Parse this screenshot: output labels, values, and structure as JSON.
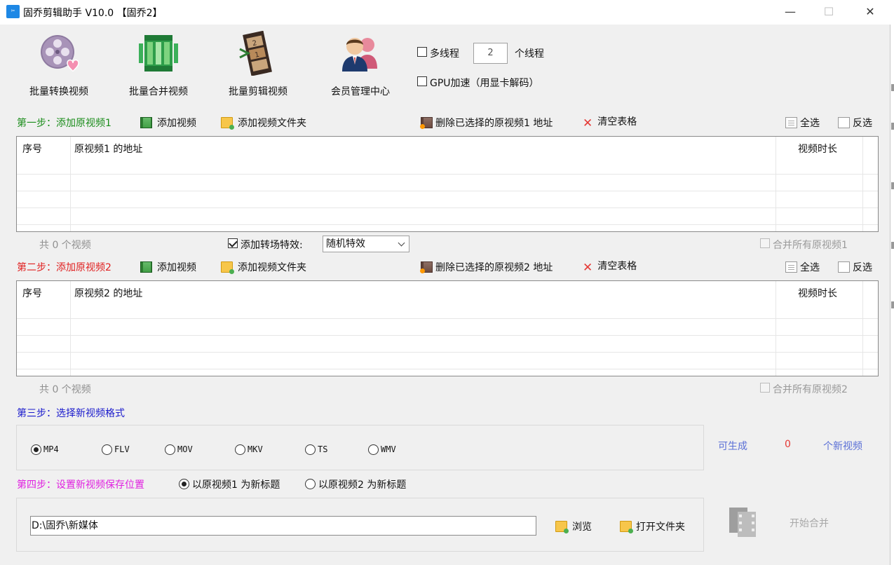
{
  "window": {
    "title": "固乔剪辑助手 V10.0 【固乔2】",
    "app_icon": "scissors-icon",
    "minimize": "—",
    "maximize": "☐",
    "close": "✕"
  },
  "toolbar": [
    {
      "label": "批量转换视频",
      "icon": "film-reel-heart-icon"
    },
    {
      "label": "批量合并视频",
      "icon": "merge-film-icon"
    },
    {
      "label": "批量剪辑视频",
      "icon": "film-strip-icon"
    },
    {
      "label": "会员管理中心",
      "icon": "users-icon"
    }
  ],
  "options": {
    "multithread_label": "多线程",
    "multithread_checked": false,
    "thread_count": "2",
    "thread_unit": "个线程",
    "gpu_label": "GPU加速（用显卡解码）",
    "gpu_checked": false
  },
  "step1": {
    "label": "第一步：添加原视频1",
    "label_color": "#1a8c1a",
    "add_video": "添加视频",
    "add_folder": "添加视频文件夹",
    "delete_selected": "删除已选择的原视频1 地址",
    "clear_table": "清空表格",
    "select_all": "全选",
    "invert_select": "反选",
    "columns": [
      "序号",
      "原视频1 的地址",
      "视频时长"
    ],
    "rows": [],
    "count_text": "共 0 个视频",
    "merge_all_label": "合并所有原视频1",
    "merge_all_checked": false
  },
  "transition": {
    "label": "添加转场特效:",
    "checked": true,
    "selected": "随机特效"
  },
  "step2": {
    "label": "第二步：添加原视频2",
    "label_color": "#e02020",
    "add_video": "添加视频",
    "add_folder": "添加视频文件夹",
    "delete_selected": "删除已选择的原视频2 地址",
    "clear_table": "清空表格",
    "select_all": "全选",
    "invert_select": "反选",
    "columns": [
      "序号",
      "原视频2 的地址",
      "视频时长"
    ],
    "rows": [],
    "count_text": "共 0 个视频",
    "merge_all_label": "合并所有原视频2",
    "merge_all_checked": false
  },
  "step3": {
    "label": "第三步：选择新视频格式",
    "label_color": "#1a1acc",
    "formats": [
      "MP4",
      "FLV",
      "MOV",
      "MKV",
      "TS",
      "WMV"
    ],
    "selected_format": "MP4",
    "can_generate": "可生成",
    "generate_count": "0",
    "new_videos": "个新视频"
  },
  "step4": {
    "label": "第四步：设置新视频保存位置",
    "label_color": "#e020e0",
    "title_option1": "以原视频1 为新标题",
    "title_option2": "以原视频2 为新标题",
    "title_selected": 1,
    "save_path": "D:\\固乔\\新媒体",
    "browse": "浏览",
    "open_folder": "打开文件夹",
    "start": "开始合并"
  }
}
